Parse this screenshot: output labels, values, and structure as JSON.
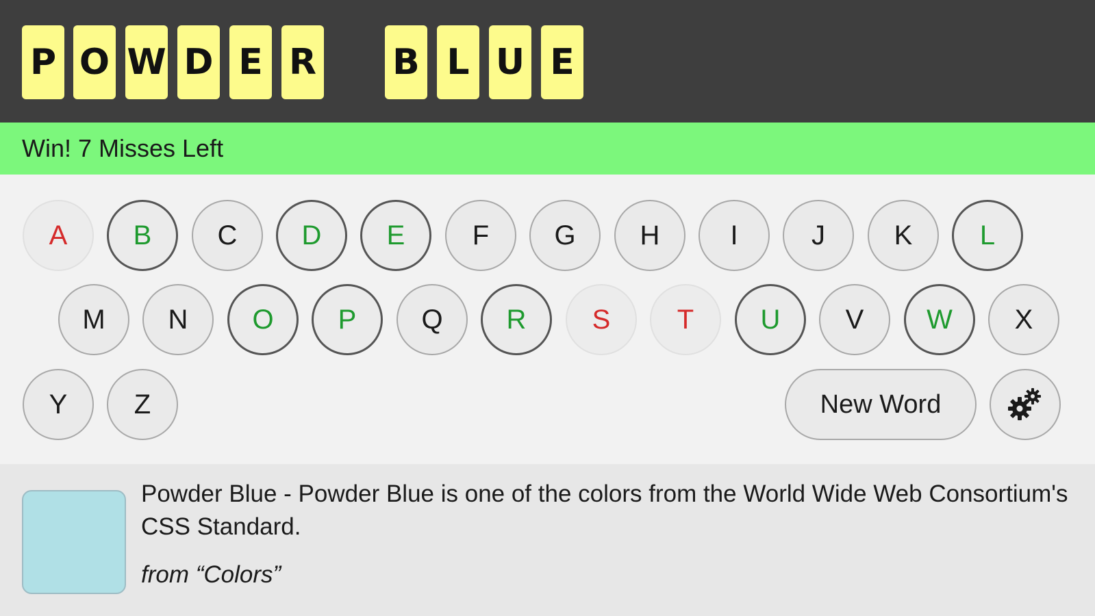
{
  "word": {
    "tiles": [
      "P",
      "O",
      "W",
      "D",
      "E",
      "R",
      "B",
      "L",
      "U",
      "E"
    ]
  },
  "status": {
    "text": "Win! 7 Misses Left",
    "color": "#7cf77c"
  },
  "keyboard": {
    "keys": [
      {
        "letter": "A",
        "state": "miss"
      },
      {
        "letter": "B",
        "state": "hit"
      },
      {
        "letter": "C",
        "state": "unused"
      },
      {
        "letter": "D",
        "state": "hit"
      },
      {
        "letter": "E",
        "state": "hit"
      },
      {
        "letter": "F",
        "state": "unused"
      },
      {
        "letter": "G",
        "state": "unused"
      },
      {
        "letter": "H",
        "state": "unused"
      },
      {
        "letter": "I",
        "state": "unused"
      },
      {
        "letter": "J",
        "state": "unused"
      },
      {
        "letter": "K",
        "state": "unused"
      },
      {
        "letter": "L",
        "state": "hit"
      },
      {
        "letter": "M",
        "state": "unused"
      },
      {
        "letter": "N",
        "state": "unused"
      },
      {
        "letter": "O",
        "state": "hit"
      },
      {
        "letter": "P",
        "state": "hit"
      },
      {
        "letter": "Q",
        "state": "unused"
      },
      {
        "letter": "R",
        "state": "hit"
      },
      {
        "letter": "S",
        "state": "miss"
      },
      {
        "letter": "T",
        "state": "miss"
      },
      {
        "letter": "U",
        "state": "hit"
      },
      {
        "letter": "V",
        "state": "unused"
      },
      {
        "letter": "W",
        "state": "hit"
      },
      {
        "letter": "X",
        "state": "unused"
      },
      {
        "letter": "Y",
        "state": "unused"
      },
      {
        "letter": "Z",
        "state": "unused"
      }
    ],
    "new_word_label": "New Word",
    "settings_icon": "gear-icon"
  },
  "info": {
    "swatch_color": "#b0e0e6",
    "description": "Powder Blue - Powder Blue is one of the colors from the World Wide Web Consortium's CSS Standard.",
    "source": "from “Colors”"
  },
  "colors": {
    "hit": "#1e9a2e",
    "miss": "#d52a2a",
    "tile": "#fdfb8c",
    "header": "#3e3e3e"
  }
}
